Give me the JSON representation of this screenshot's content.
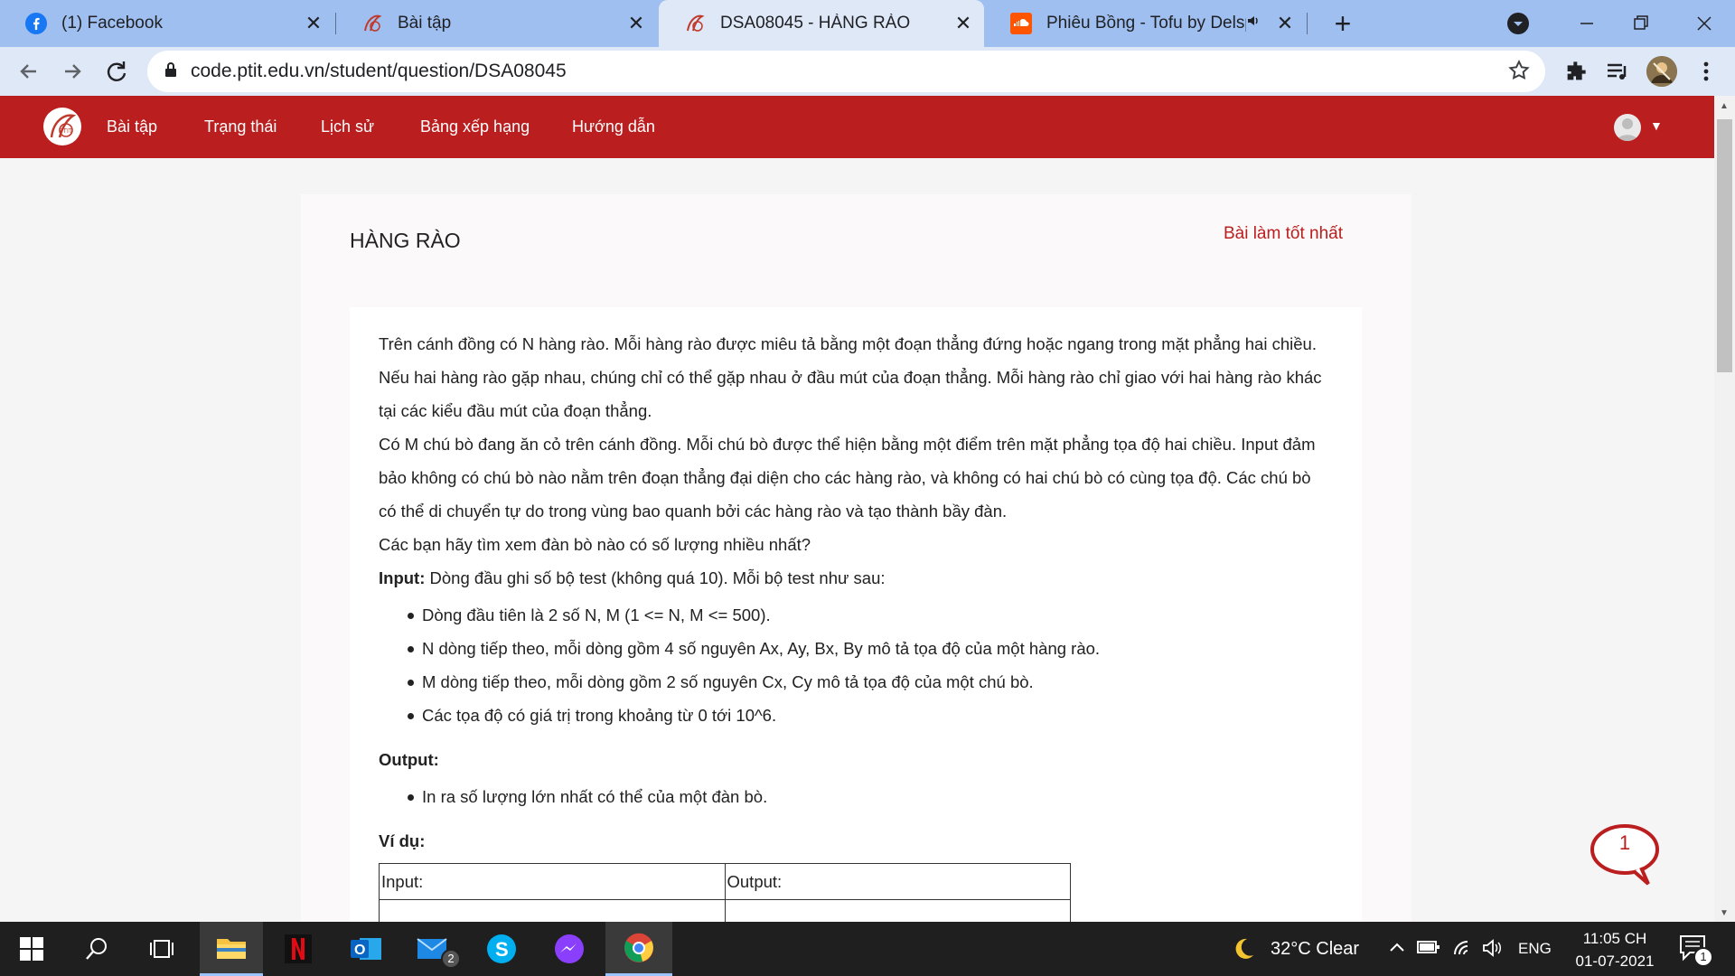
{
  "browser": {
    "tabs": [
      {
        "title": "(1) Facebook"
      },
      {
        "title": "Bài tập"
      },
      {
        "title": "DSA08045 - HÀNG RÀO"
      },
      {
        "title": "Phiêu Bồng - Tofu by Delspx"
      }
    ],
    "new_tab": "+",
    "url": "code.ptit.edu.vn/student/question/DSA08045"
  },
  "site": {
    "nav": [
      "Bài tập",
      "Trạng thái",
      "Lịch sử",
      "Bảng xếp hạng",
      "Hướng dẫn"
    ],
    "brand_color": "#bb1e1e"
  },
  "question": {
    "title": "HÀNG RÀO",
    "best_link": "Bài làm tốt nhất",
    "paragraphs": [
      "Trên cánh đồng có N hàng rào. Mỗi hàng rào được miêu tả bằng một đoạn thẳng đứng hoặc ngang trong mặt phẳng hai chiều. Nếu hai hàng rào gặp nhau, chúng chỉ có thể gặp nhau ở đầu mút của đoạn thẳng. Mỗi hàng rào chỉ giao với hai hàng rào khác tại các kiểu đầu mút của đoạn thẳng.",
      "Có M chú bò đang ăn cỏ trên cánh đồng. Mỗi chú bò được thể hiện bằng một điểm trên mặt phẳng tọa độ hai chiều. Input đảm bảo không có chú bò nào nằm trên đoạn thẳng đại diện cho các hàng rào, và không có hai chú bò có cùng tọa độ. Các chú bò có thể di chuyển tự do trong vùng bao quanh bởi các hàng rào và tạo thành bầy đàn.",
      "Các bạn hãy tìm xem đàn bò nào có số lượng nhiều nhất?"
    ],
    "input_label": "Input:",
    "input_text": " Dòng đầu ghi số bộ test (không quá 10). Mỗi bộ test như sau:",
    "input_items": [
      "Dòng đầu tiên là 2 số N, M (1 <= N, M <= 500).",
      "N dòng tiếp theo, mỗi dòng gồm 4 số nguyên Ax, Ay, Bx, By mô tả tọa độ của một hàng rào.",
      "M dòng tiếp theo, mỗi dòng gồm 2 số nguyên Cx, Cy mô tả tọa độ của một chú bò.",
      "Các tọa độ có giá trị trong khoảng từ 0 tới 10^6."
    ],
    "output_label": "Output:",
    "output_items": [
      "In ra số lượng lớn nhất có thể của một đàn bò."
    ],
    "example_label": "Ví dụ:",
    "example_headers": [
      "Input:",
      "Output:"
    ]
  },
  "chat": {
    "badge": "1"
  },
  "taskbar": {
    "mail_badge": "2",
    "weather": "32°C  Clear",
    "language": "ENG",
    "time": "11:05 CH",
    "date": "01-07-2021",
    "notification_badge": "1"
  }
}
